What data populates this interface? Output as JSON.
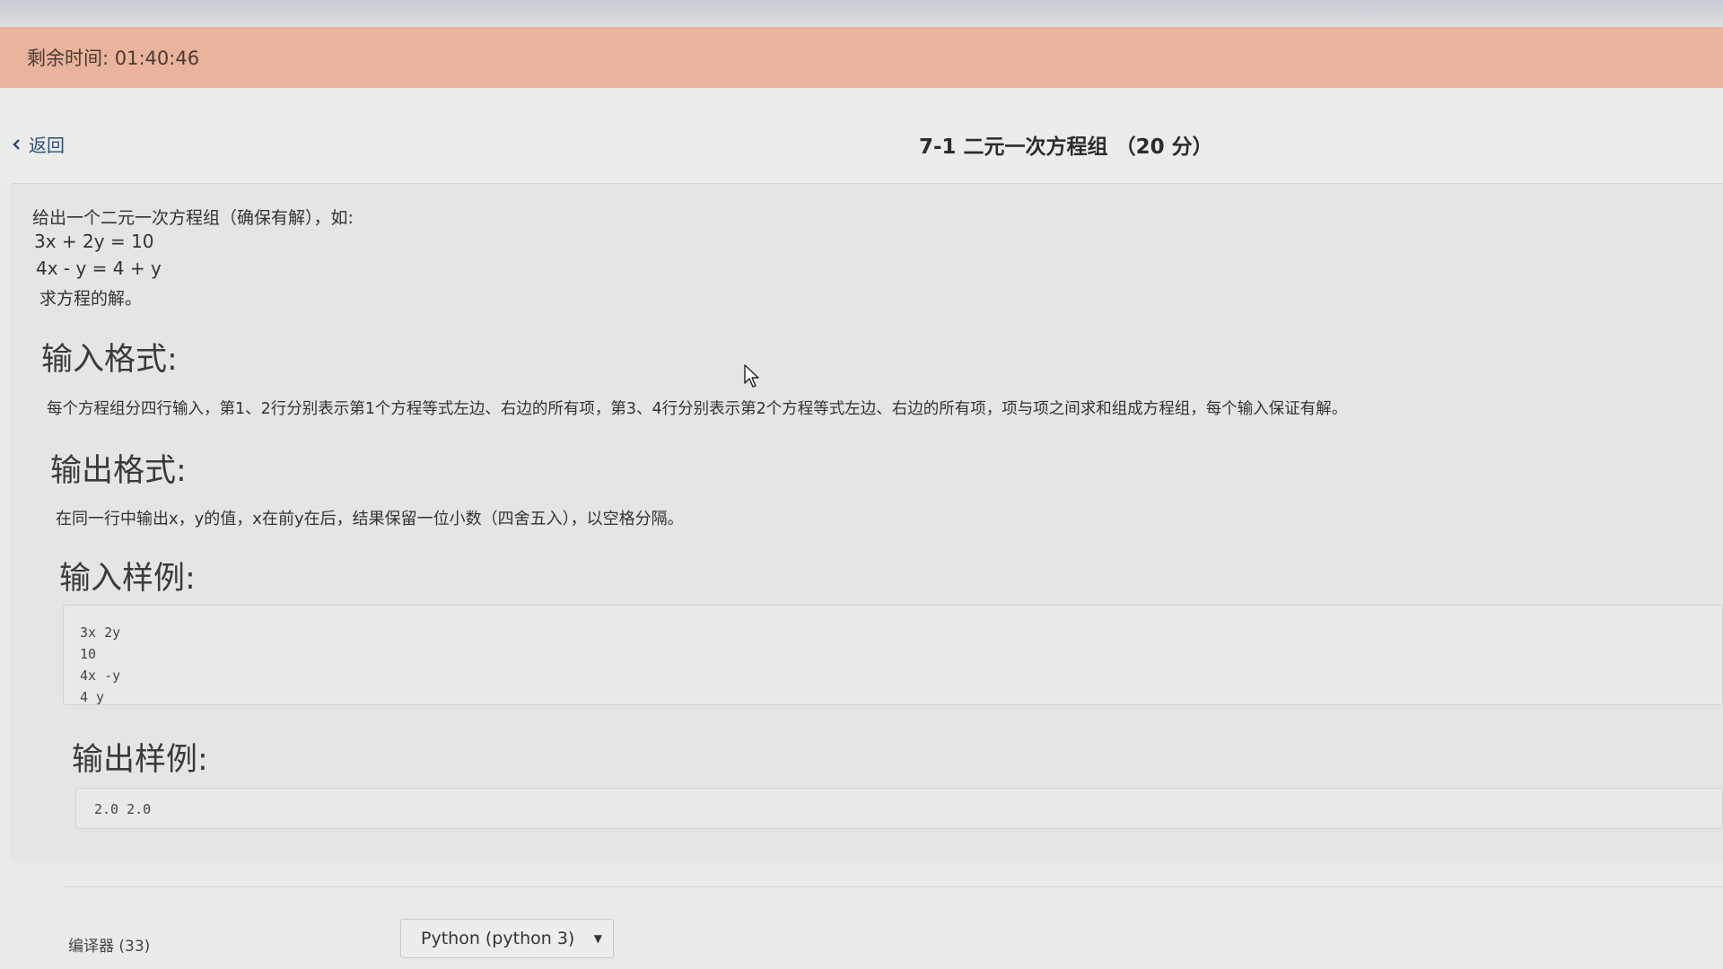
{
  "timer": {
    "label": "剩余时间: 01:40:46"
  },
  "header": {
    "back_label": "返回",
    "title": "7-1 二元一次方程组 （20 分）"
  },
  "problem": {
    "intro_lines": [
      "给出一个二元一次方程组（确保有解），如:",
      "3x + 2y = 10",
      "4x - y = 4 + y",
      "求方程的解。"
    ],
    "input_format_heading": "输入格式:",
    "input_format_text": "每个方程组分四行输入，第1、2行分别表示第1个方程等式左边、右边的所有项，第3、4行分别表示第2个方程等式左边、右边的所有项，项与项之间求和组成方程组，每个输入保证有解。",
    "output_format_heading": "输出格式:",
    "output_format_text": "在同一行中输出x，y的值，x在前y在后，结果保留一位小数（四舍五入），以空格分隔。",
    "sample_input_heading": "输入样例:",
    "sample_input_lines": [
      "3x 2y",
      "10",
      "4x -y",
      "4 y"
    ],
    "sample_output_heading": "输出样例:",
    "sample_output_lines": [
      "2.0 2.0"
    ]
  },
  "footer": {
    "compiler_label": "编译器 (33)",
    "compiler_selected": "Python (python 3)"
  },
  "colors": {
    "timer_bar": "#e9b49b",
    "link": "#2e4f7a",
    "background": "#e9ebe8"
  }
}
